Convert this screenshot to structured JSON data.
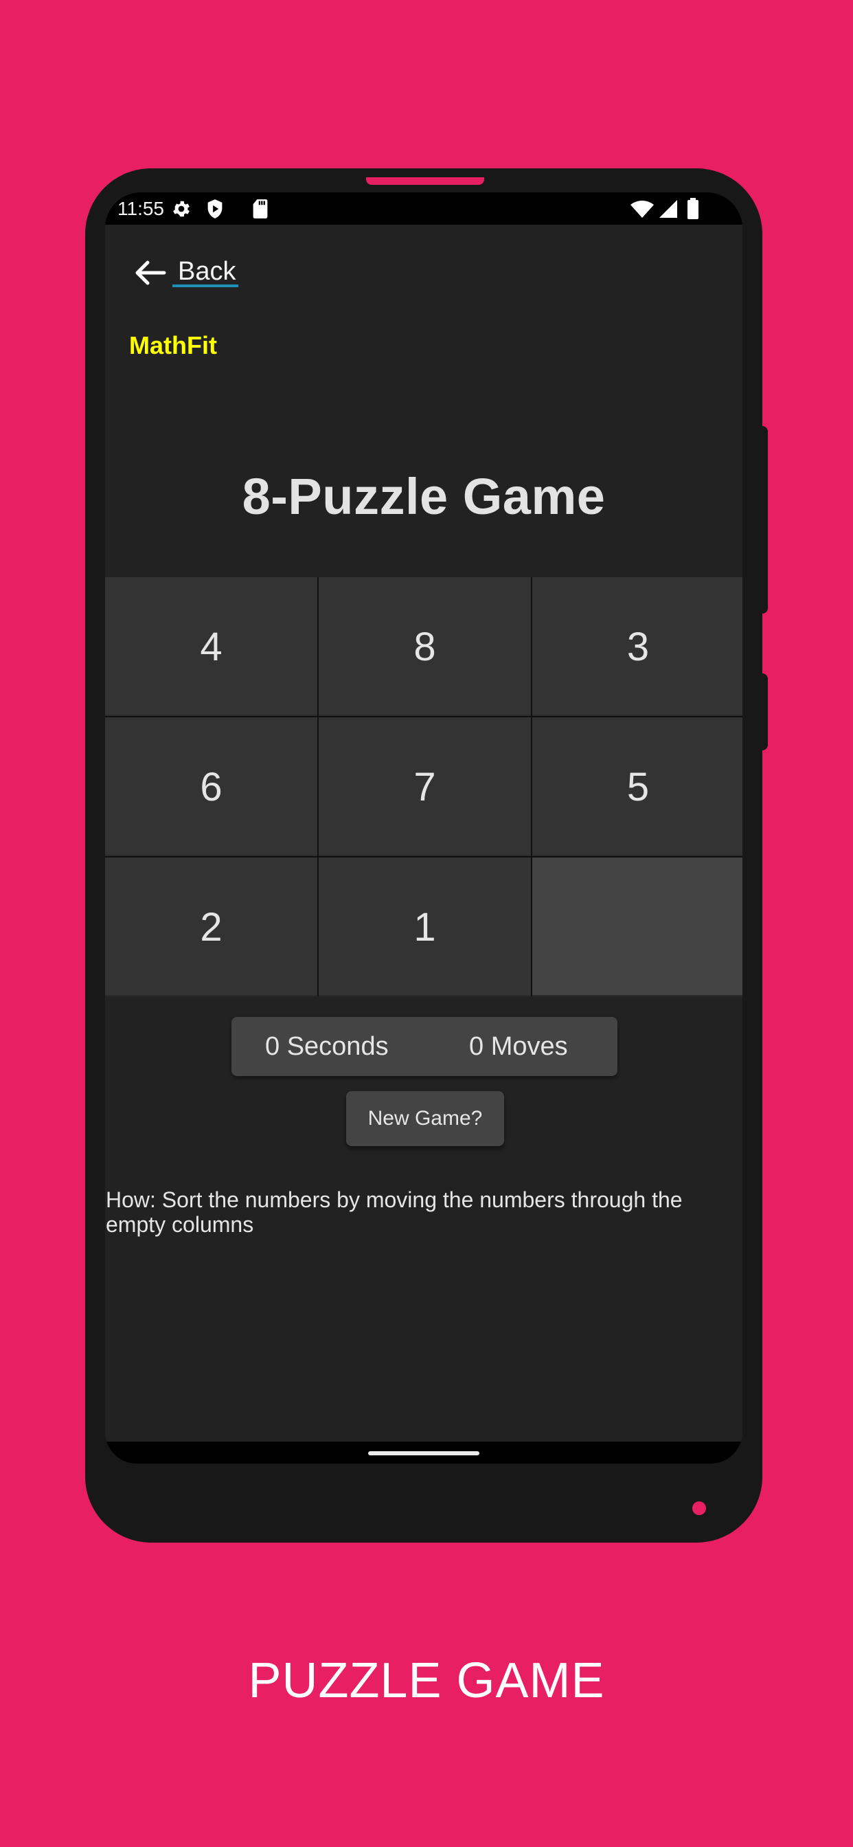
{
  "status_bar": {
    "time": "11:55",
    "left_icons": [
      "gear-icon",
      "shield-play-icon",
      "sd-card-icon"
    ],
    "right_icons": [
      "wifi-icon",
      "cell-signal-icon",
      "battery-icon"
    ]
  },
  "header": {
    "back_label": "Back",
    "brand": "MathFit"
  },
  "game": {
    "title": "8-Puzzle Game",
    "tiles": [
      "4",
      "8",
      "3",
      "6",
      "7",
      "5",
      "2",
      "1",
      ""
    ],
    "seconds": "0 Seconds",
    "moves": "0 Moves",
    "new_game_label": "New Game?",
    "instructions": "How: Sort the numbers by moving the numbers through the empty columns"
  },
  "caption": "PUZZLE GAME",
  "colors": {
    "background": "#E81F63",
    "brand": "#FFFF00",
    "link_underline": "#1E90B8",
    "app_bg": "#222222",
    "tile": "#333333",
    "empty_tile": "#444444"
  }
}
